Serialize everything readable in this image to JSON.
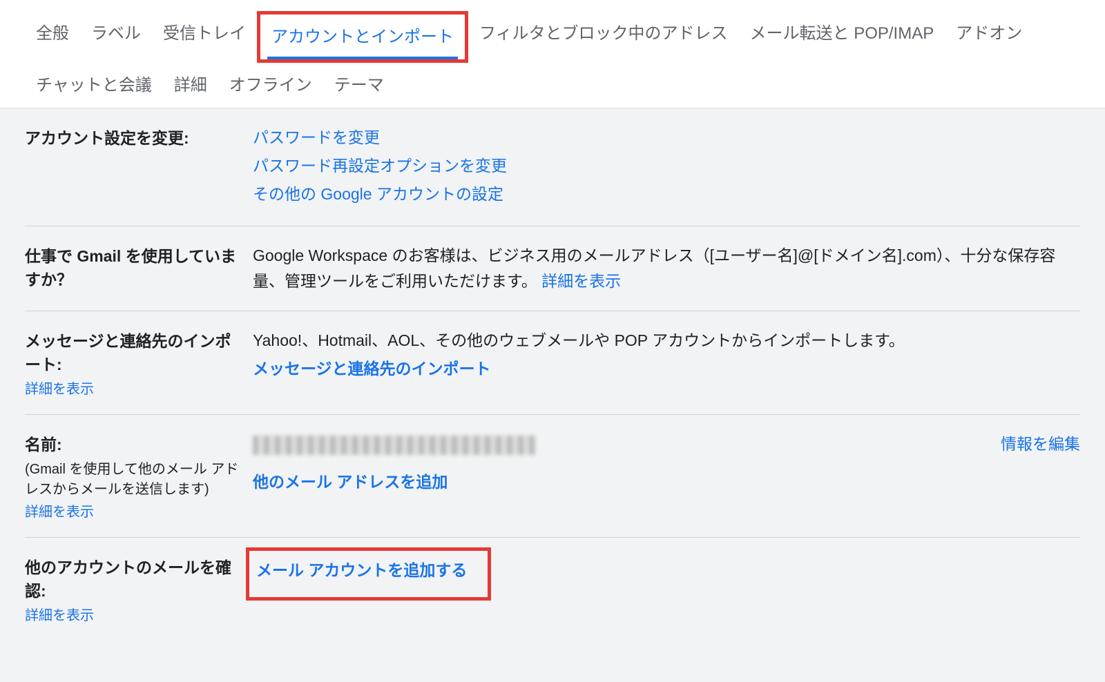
{
  "tabs": {
    "general": "全般",
    "labels": "ラベル",
    "inbox": "受信トレイ",
    "accounts_import": "アカウントとインポート",
    "filters_blocked": "フィルタとブロック中のアドレス",
    "forwarding_pop_imap": "メール転送と POP/IMAP",
    "addons": "アドオン",
    "chat_meet": "チャットと会議",
    "advanced": "詳細",
    "offline": "オフライン",
    "themes": "テーマ"
  },
  "account_settings": {
    "label": "アカウント設定を変更:",
    "change_password": "パスワードを変更",
    "change_recovery": "パスワード再設定オプションを変更",
    "other_google_settings": "その他の Google アカウントの設定"
  },
  "gmail_work": {
    "label": "仕事で Gmail を使用していますか？",
    "description_prefix": "Google Workspace のお客様は、ビジネス用のメールアドレス（[ユーザー名]@[ドメイン名].com）、十分な保存容量、管理ツールをご利用いただけます。",
    "learn_more": "詳細を表示"
  },
  "import_section": {
    "label": "メッセージと連絡先のインポート:",
    "learn_more": "詳細を表示",
    "description": "Yahoo!、Hotmail、AOL、その他のウェブメールや POP アカウントからインポートします。",
    "import_link": "メッセージと連絡先のインポート"
  },
  "name_section": {
    "label": "名前:",
    "sub": "(Gmail を使用して他のメール アドレスからメールを送信します)",
    "learn_more": "詳細を表示",
    "add_another": "他のメール アドレスを追加",
    "edit_info": "情報を編集"
  },
  "check_other": {
    "label": "他のアカウントのメールを確認:",
    "learn_more": "詳細を表示",
    "add_account": "メール アカウントを追加する"
  }
}
